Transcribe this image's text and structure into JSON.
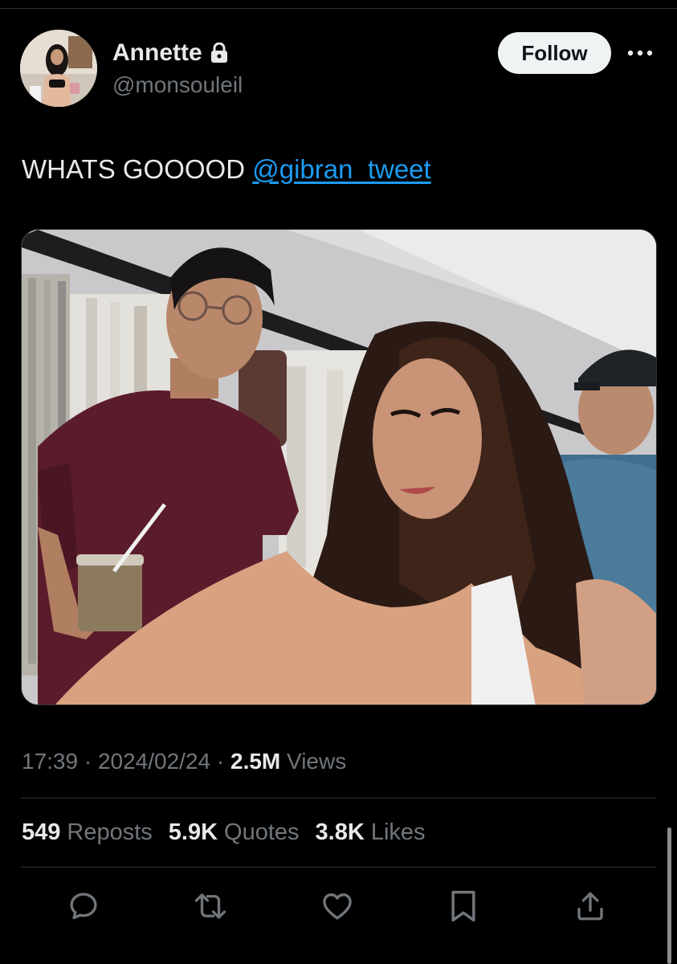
{
  "author": {
    "display_name": "Annette",
    "handle": "@monsouleil",
    "protected": true
  },
  "follow_label": "Follow",
  "tweet": {
    "text": "WHATS GOOOOD ",
    "mention": "@gibran_tweet"
  },
  "meta": {
    "time": "17:39",
    "separator": "·",
    "date": "2024/02/24",
    "views_count": "2.5M",
    "views_label": "Views"
  },
  "stats": {
    "reposts_count": "549",
    "reposts_label": "Reposts",
    "quotes_count": "5.9K",
    "quotes_label": "Quotes",
    "likes_count": "3.8K",
    "likes_label": "Likes"
  },
  "actions": [
    "reply-icon",
    "repost-icon",
    "like-icon",
    "bookmark-icon",
    "share-icon"
  ],
  "colors": {
    "background": "#000000",
    "text": "#e7e9ea",
    "secondary_text": "#71767b",
    "link": "#1d9bf0",
    "divider": "#2f3336",
    "follow_button": "#eff3f4"
  }
}
